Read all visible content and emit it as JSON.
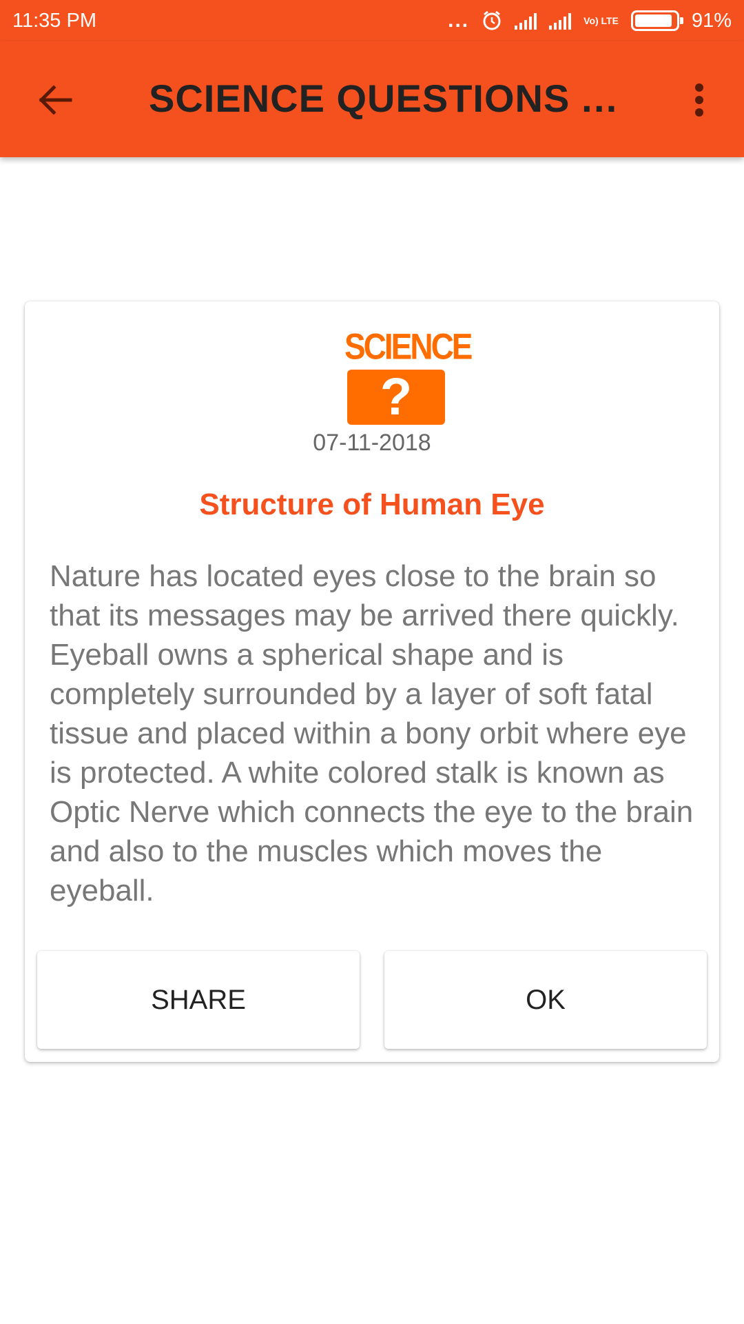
{
  "status_bar": {
    "time": "11:35 PM",
    "more": "...",
    "network": "Vo) LTE",
    "battery_percent": "91%",
    "battery_level": 0.91
  },
  "app_bar": {
    "title": "SCIENCE QUESTIONS AN...",
    "back_icon": "arrow-left-icon",
    "menu_icon": "more-vertical-icon"
  },
  "card": {
    "logo": {
      "word": "SCIENCE",
      "mark": "?"
    },
    "date": "07-11-2018",
    "title": "Structure of Human Eye",
    "body": "Nature has located eyes close to the brain so that its messages may be arrived there quickly. Eyeball owns a spherical shape and is completely surrounded by a layer of soft fatal tissue and placed within a bony orbit where eye is protected. A white colored stalk is known as Optic Nerve which connects the eye to the brain and also to the muscles which moves the eyeball.",
    "share_label": "SHARE",
    "ok_label": "OK"
  },
  "colors": {
    "primary": "#f4511e",
    "logo_orange": "#ff6d00"
  }
}
